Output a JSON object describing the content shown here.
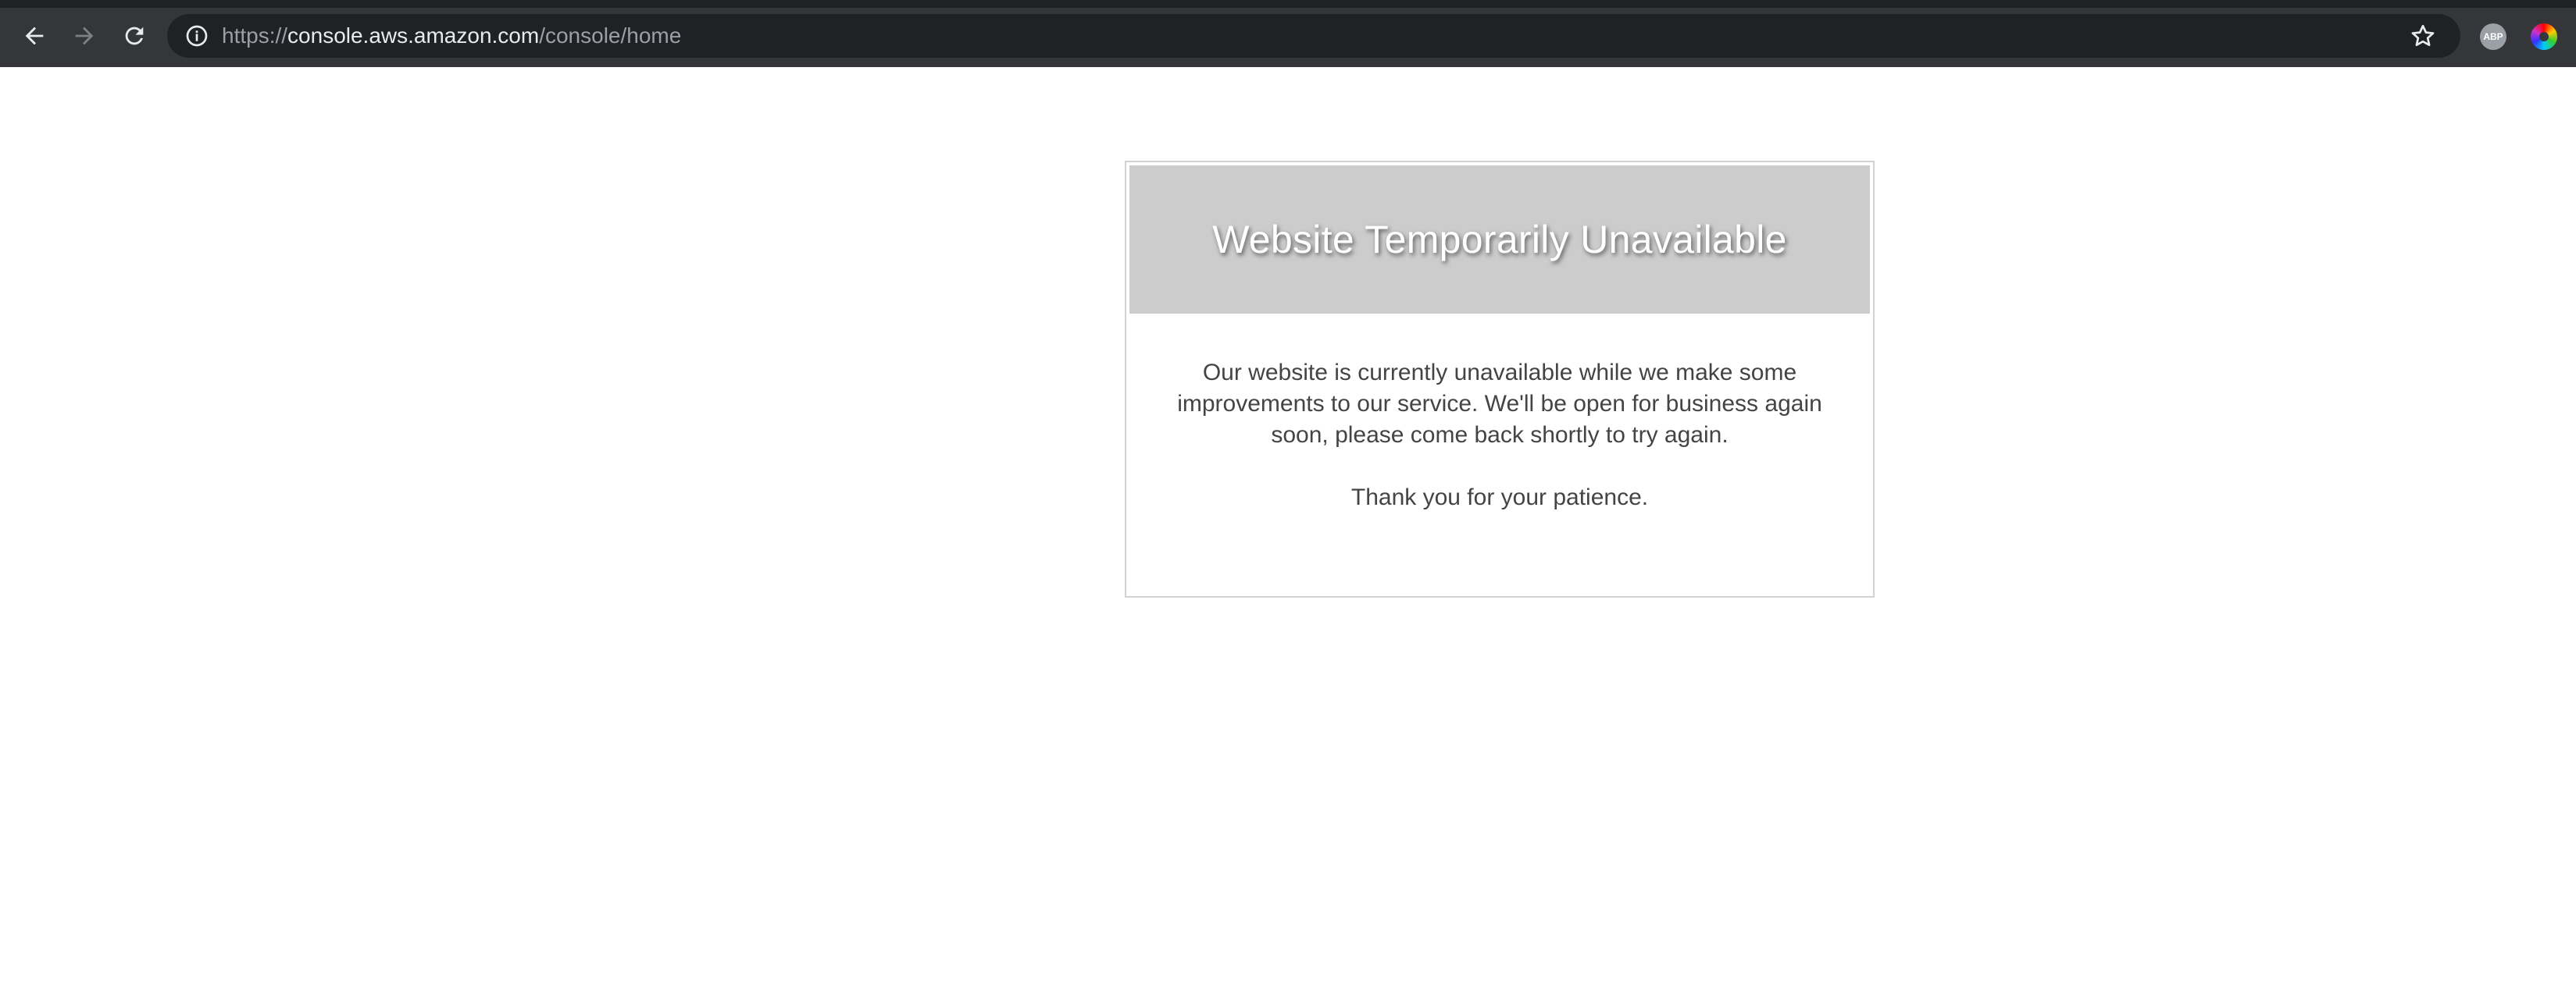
{
  "browser": {
    "url_scheme": "https://",
    "url_host": "console.aws.amazon.com",
    "url_path": "/console/home",
    "icons": {
      "back": "back-arrow-icon",
      "forward": "forward-arrow-icon",
      "reload": "reload-icon",
      "info": "info-icon",
      "bookmark": "star-icon"
    },
    "extensions": {
      "abp_label": "ABP"
    }
  },
  "maintenance": {
    "title": "Website Temporarily Unavailable",
    "message": "Our website is currently unavailable while we make some improvements to our service. We'll be open for business again soon, please come back shortly to try again.",
    "thanks": "Thank you for your patience."
  },
  "colors": {
    "header_bg": "#cccccc",
    "toolbar_bg": "#35363a",
    "omnibox_bg": "#202124"
  }
}
